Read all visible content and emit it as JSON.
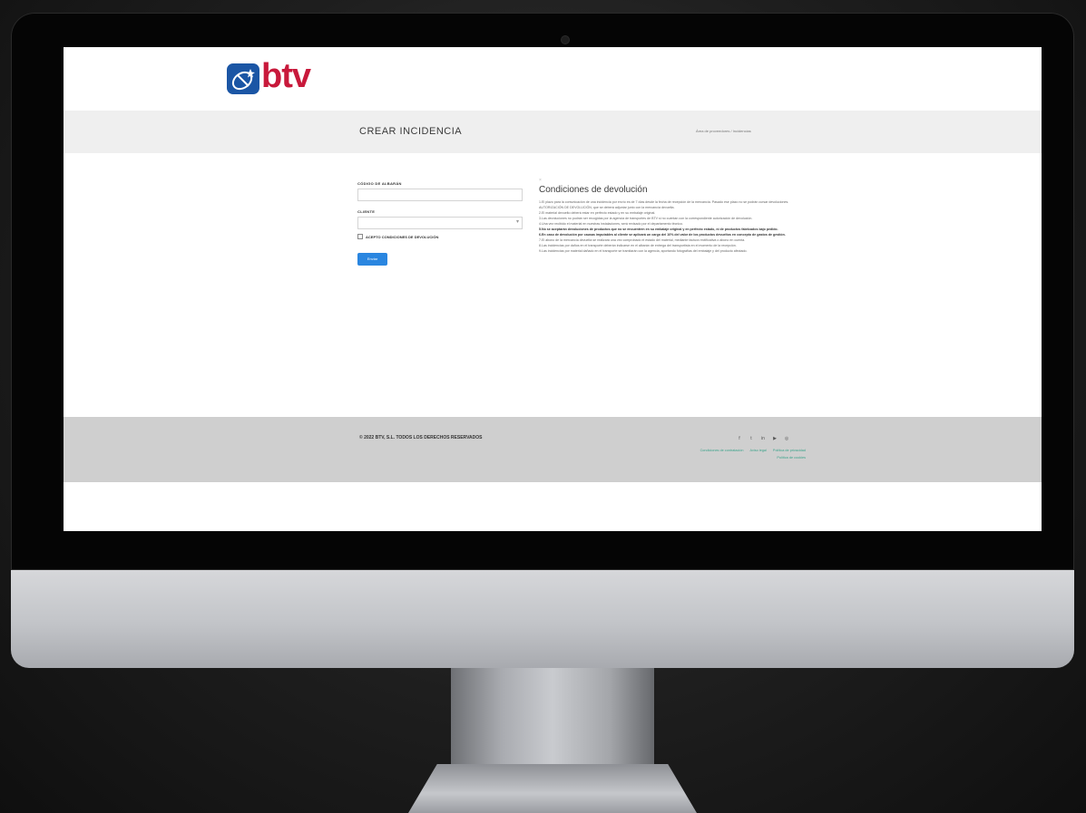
{
  "logo": {
    "text": "btv",
    "brand_blue": "#1b56a5",
    "brand_red": "#c8193b"
  },
  "page_title": "CREAR INCIDENCIA",
  "breadcrumb": "Área de proveedores / Incidencias",
  "form": {
    "albaran_label": "CÓDIGO DE ALBARÁN",
    "albaran_value": "",
    "cliente_label": "CLIENTE",
    "cliente_value": "",
    "accept_label": "ACEPTO CONDICIONES DE DEVOLUCIÓN",
    "accept_checked": false,
    "submit_label": "Enviar",
    "accent": "#2a86e0"
  },
  "terms": {
    "close_glyph": "×",
    "title": "Condiciones de devolución",
    "paragraphs": [
      {
        "text": "1.El plazo para la comunicación de una incidencia por envío es de 7 días desde la fecha de recepción de la mercancía. Pasado ese plazo no se podrán cursar devoluciones.",
        "strong": false
      },
      {
        "text": "AUTORIZACIÓN DE DEVOLUCIÓN, que se deberá adjuntar junto con la mercancía devuelta.",
        "strong": false
      },
      {
        "text": "2.El material devuelto deberá estar en perfecto estado y en su embalaje original.",
        "strong": false
      },
      {
        "text": "3.Las devoluciones no podrán ser recogidas por la agencia de transportes de BTV si no cuentan con la correspondiente autorización de devolución.",
        "strong": false
      },
      {
        "text": "4.Una vez recibido el material en nuestras instalaciones, será revisado por el departamento técnico.",
        "strong": false
      },
      {
        "text": "5.No se aceptarán devoluciones de productos que no se encuentren en su embalaje original y en perfecto estado, ni de productos fabricados bajo pedido.",
        "strong": true
      },
      {
        "text": "6.En caso de devolución por causas imputables al cliente se aplicará un cargo del 10% del valor de los productos devueltos en concepto de gastos de gestión.",
        "strong": true
      },
      {
        "text": "7.El abono de la mercancía devuelta se realizará una vez comprobado el estado del material, mediante factura rectificativa o abono en cuenta.",
        "strong": false
      },
      {
        "text": "8.Las incidencias por daños en el transporte deberán indicarse en el albarán de entrega del transportista en el momento de la recepción.",
        "strong": false
      },
      {
        "text": "9.Las incidencias por material dañado en el transporte se tramitarán con la agencia, aportando fotografías del embalaje y del producto afectado.",
        "strong": false
      }
    ]
  },
  "footer": {
    "copyright": "© 2022 BTV, S.L. TODOS LOS DERECHOS RESERVADOS",
    "social": [
      "f",
      "t",
      "in",
      "▶",
      "◎"
    ],
    "links": [
      "Condiciones de contratación",
      "Aviso legal",
      "Política de privacidad",
      "Política de cookies"
    ],
    "link_color": "#3aa38a"
  }
}
